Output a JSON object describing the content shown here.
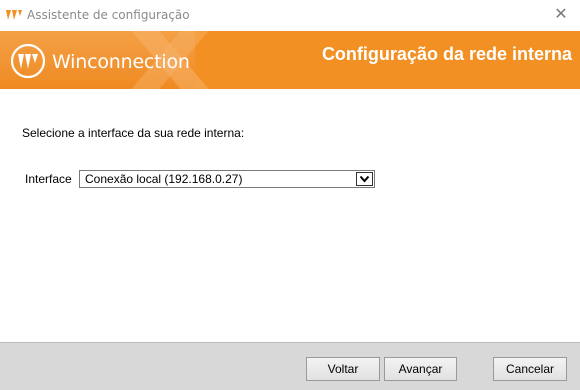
{
  "window": {
    "title": "Assistente de configuração",
    "close_icon": "close-icon"
  },
  "banner": {
    "brand": "Winconnection",
    "title": "Configuração da rede interna",
    "accent_color": "#f29023"
  },
  "content": {
    "instruction": "Selecione a interface da sua rede interna:",
    "interface_label": "Interface",
    "interface_selected": "Conexão local (192.168.0.27)"
  },
  "footer": {
    "back_label": "Voltar",
    "next_label": "Avançar",
    "cancel_label": "Cancelar"
  }
}
